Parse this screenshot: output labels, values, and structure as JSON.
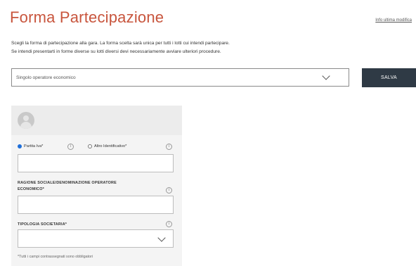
{
  "header": {
    "title": "Forma Partecipazione",
    "info_link": "Info ultima modifica"
  },
  "description": {
    "line1": "Scegli la forma di partecipazione alla gara. La forma scelta sarà unica per tutti i lotti cui intendi partecipare.",
    "line2": "Se intendi presentarti in forme diverse su lotti diversi devi necessariamente avviare ulteriori procedure."
  },
  "form_select": {
    "selected": "Singolo operatore economico"
  },
  "actions": {
    "save_label": "SALVA"
  },
  "card": {
    "radio_partita_iva": "Partita Iva*",
    "radio_altro": "Altro Identificativo*",
    "selected_radio": "partita_iva",
    "ragione_sociale_label_line1": "RAGIONE SOCIALE/DENOMINAZIONE OPERATORE",
    "ragione_sociale_label_line2": "ECONOMICO*",
    "tipologia_label": "TIPOLOGIA SOCIETARIA*",
    "required_note": "*Tutti i campi contrassegnati sono obbligatori",
    "info_glyph": "i"
  }
}
